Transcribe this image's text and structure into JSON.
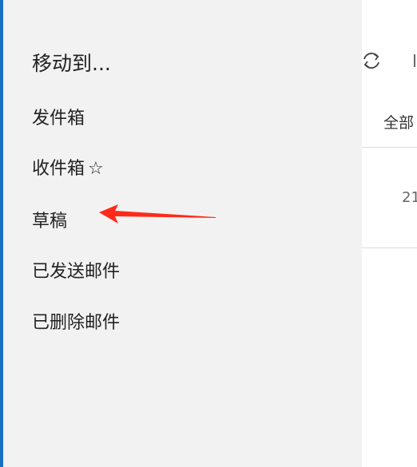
{
  "panel": {
    "title": "移动到...",
    "accent_color": "#1a6fc2",
    "folders": [
      {
        "label": "发件箱",
        "icon": ""
      },
      {
        "label": "收件箱",
        "icon": "☆"
      },
      {
        "label": "草稿",
        "icon": ""
      },
      {
        "label": "已发送邮件",
        "icon": ""
      },
      {
        "label": "已删除邮件",
        "icon": ""
      }
    ]
  },
  "mail_list": {
    "filter_label": "全部",
    "first_mail_date": "21",
    "sync_icon": "sync-icon",
    "more_icon": "more-icon"
  },
  "annotation": {
    "arrow_color": "#ff2a1a",
    "arrow_target": "草稿"
  }
}
